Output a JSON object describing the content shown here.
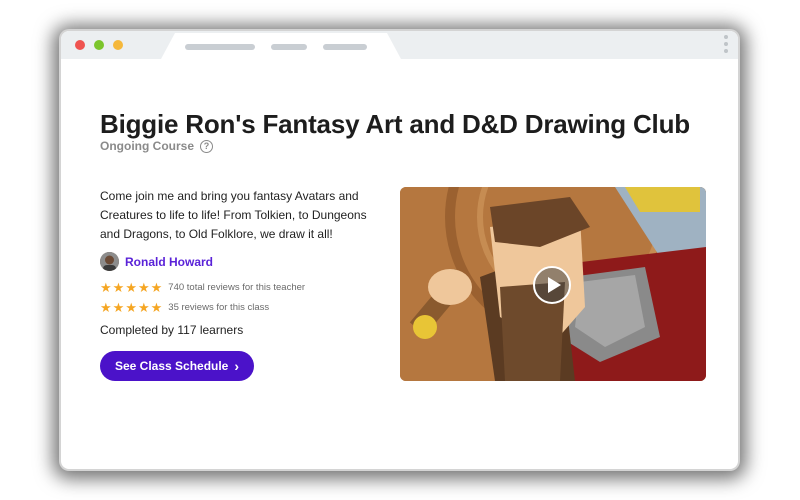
{
  "course": {
    "title": "Biggie Ron's Fantasy Art and D&D Drawing Club",
    "type_label": "Ongoing Course",
    "description": "Come join me and bring you fantasy Avatars and Creatures to life to life! From Tolkien, to Dungeons and Dragons, to Old Folklore, we draw it all!",
    "completed_text": "Completed by 117 learners",
    "cta_label": "See Class Schedule",
    "cta_icon": "chevron-right-icon"
  },
  "teacher": {
    "name": "Ronald Howard"
  },
  "ratings": {
    "teacher": {
      "stars": 5,
      "text": "740 total reviews for this teacher"
    },
    "class": {
      "stars": 5,
      "text": "35 reviews for this class"
    }
  },
  "media": {
    "play_icon": "play-icon"
  },
  "colors": {
    "accent": "#4b12c9",
    "teacher_link": "#5a22d8",
    "star": "#f5a623"
  }
}
